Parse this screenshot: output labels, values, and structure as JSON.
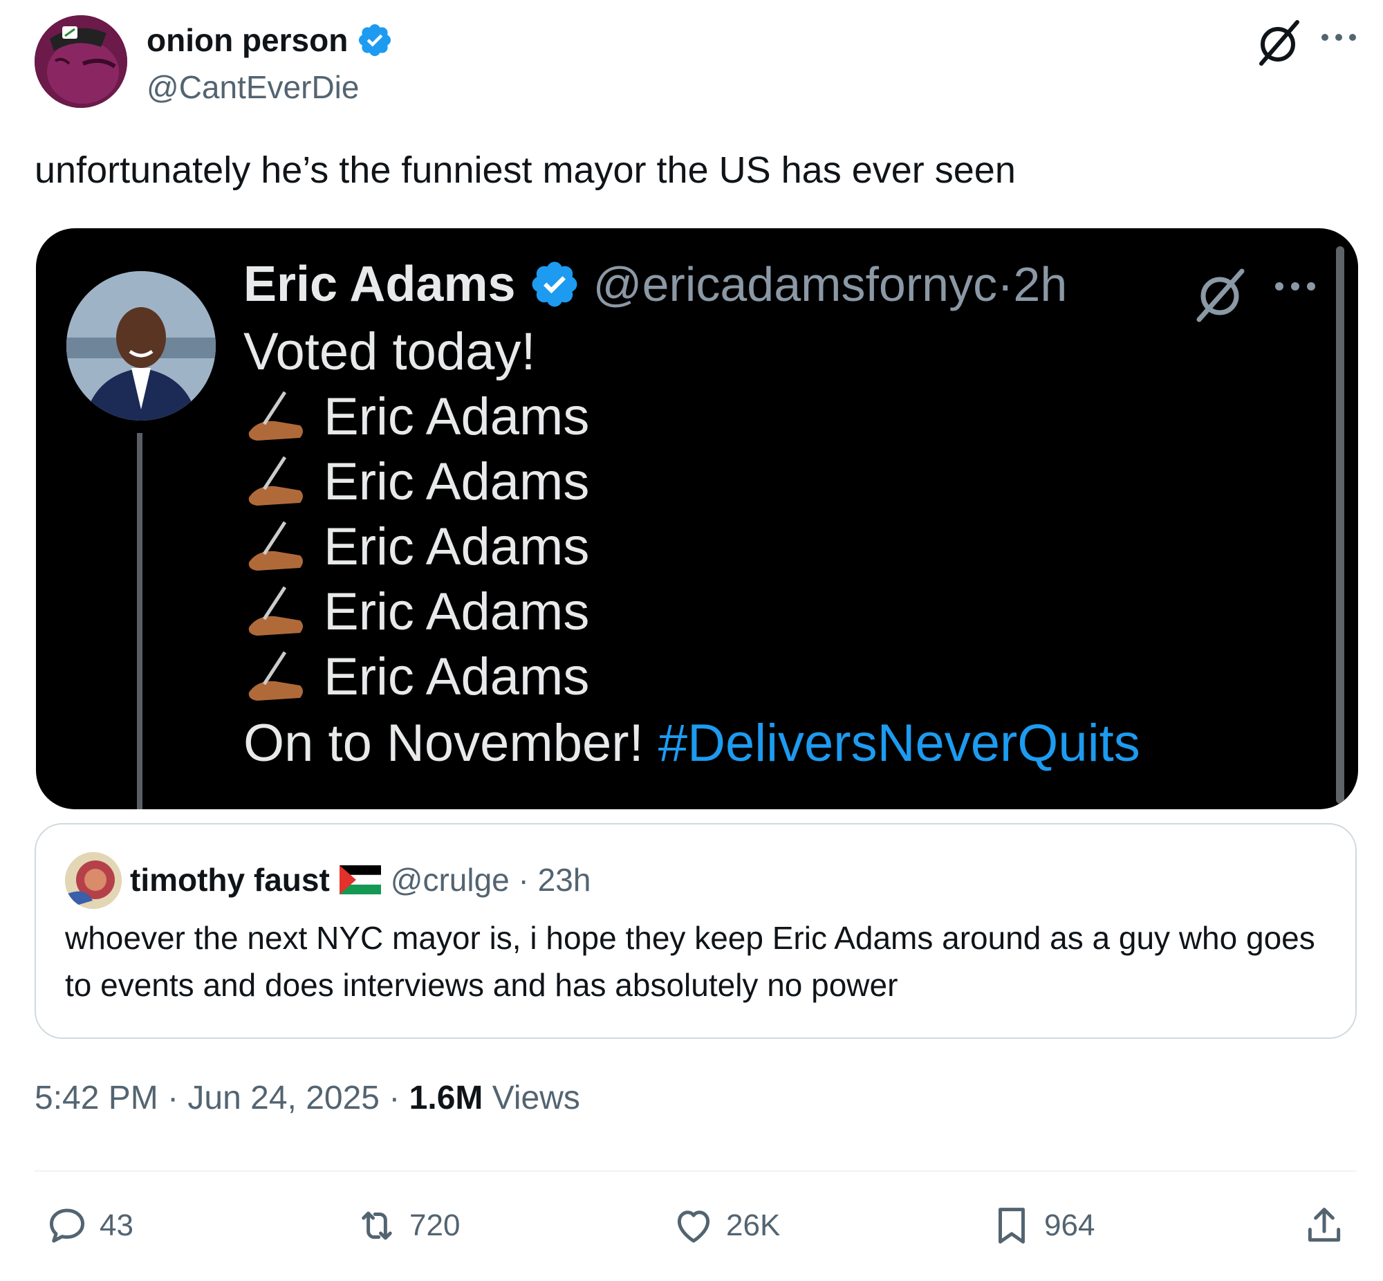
{
  "author": {
    "display_name": "onion person",
    "handle": "@CantEverDie",
    "verified": true
  },
  "tweet": {
    "text": "unfortunately he’s the funniest mayor the US has ever seen"
  },
  "screenshot": {
    "name": "Eric Adams",
    "handle": "@ericadamsfornyc",
    "separator": "·",
    "time": "2h",
    "line1": "Voted today!",
    "signatures": [
      "Eric Adams",
      "Eric Adams",
      "Eric Adams",
      "Eric Adams",
      "Eric Adams"
    ],
    "last_line_text": "On to November! ",
    "hashtag": "#DeliversNeverQuits"
  },
  "quote": {
    "name": "timothy faust",
    "handle": "@crulge",
    "separator": "·",
    "time": "23h",
    "text": "whoever the next NYC mayor is, i hope they keep Eric Adams around as a guy who goes to events and does interviews and has absolutely no power"
  },
  "meta": {
    "time": "5:42 PM",
    "sep1": " · ",
    "date": "Jun 24, 2025",
    "sep2": " · ",
    "views_count": "1.6M",
    "views_label": " Views"
  },
  "actions": {
    "replies": "43",
    "reposts": "720",
    "likes": "26K",
    "bookmarks": "964"
  },
  "icons": {
    "verified": "verified-badge-icon",
    "grok": "grok-icon",
    "more": "more-icon",
    "reply": "reply-icon",
    "repost": "repost-icon",
    "like": "heart-icon",
    "bookmark": "bookmark-icon",
    "share": "share-icon"
  },
  "colors": {
    "accent": "#1d9bf0",
    "text": "#0f1419",
    "secondary": "#536471",
    "border": "#cfd9de"
  }
}
